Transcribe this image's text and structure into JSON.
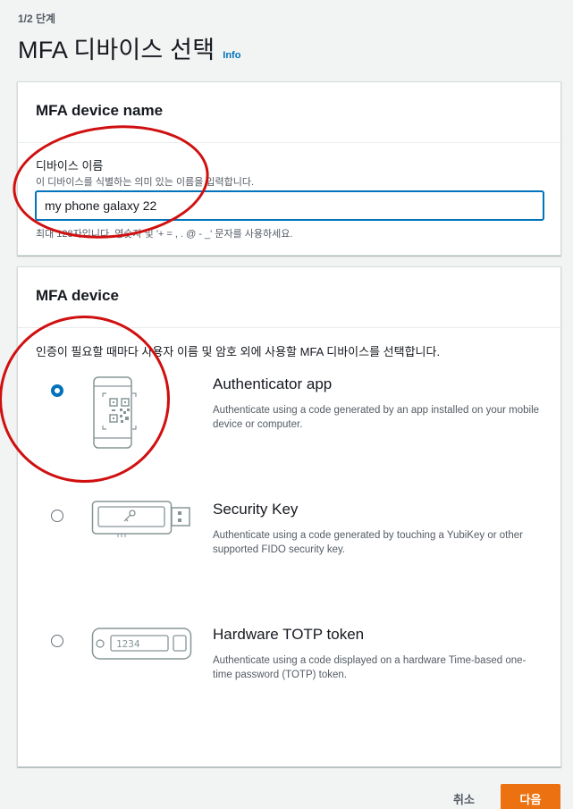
{
  "header": {
    "step": "1/2 단계",
    "title": "MFA 디바이스 선택",
    "info_link": "Info"
  },
  "device_name_panel": {
    "heading": "MFA device name",
    "field_label": "디바이스 이름",
    "field_description": "이 디바이스를 식별하는 의미 있는 이름을 입력합니다.",
    "field_value": "my phone galaxy 22",
    "field_constraint": "최대 128자입니다. 영숫자 및 '+ = , . @ - _' 문자를 사용하세요."
  },
  "device_panel": {
    "heading": "MFA device",
    "description": "인증이 필요할 때마다 사용자 이름 및 암호 외에 사용할 MFA 디바이스를 선택합니다.",
    "selected_option": "authenticator-app",
    "options": [
      {
        "id": "authenticator-app",
        "title": "Authenticator app",
        "description": "Authenticate using a code generated by an app installed on your mobile device or computer.",
        "icon": "phone-qr-icon"
      },
      {
        "id": "security-key",
        "title": "Security Key",
        "description": "Authenticate using a code generated by touching a YubiKey or other supported FIDO security key.",
        "icon": "usb-key-icon"
      },
      {
        "id": "hardware-totp",
        "title": "Hardware TOTP token",
        "description": "Authenticate using a code displayed on a hardware Time-based one-time password (TOTP) token.",
        "icon": "totp-token-icon",
        "token_display": "1234"
      }
    ]
  },
  "footer": {
    "cancel_label": "취소",
    "next_label": "다음"
  },
  "colors": {
    "accent": "#0073bb",
    "primary_button": "#ec7211",
    "annotation": "#d01010"
  }
}
